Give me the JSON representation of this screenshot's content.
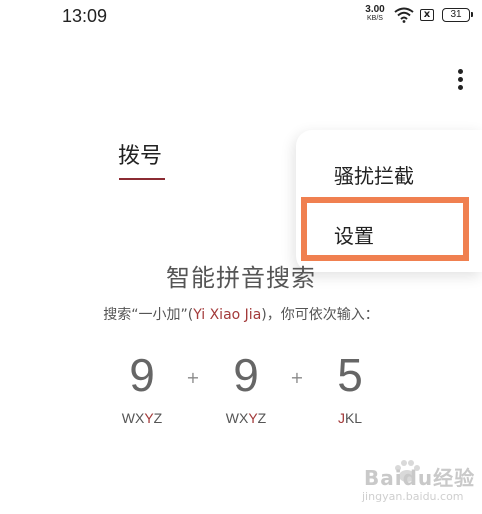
{
  "status_bar": {
    "time": "13:09",
    "net_speed_value": "3.00",
    "net_speed_unit": "KB/S",
    "sim_icon": "x",
    "battery": "31"
  },
  "tabs": {
    "dial": "拨号"
  },
  "menu": {
    "items": [
      {
        "label": "骚扰拦截"
      },
      {
        "label": "设置"
      }
    ],
    "highlighted_item": "设置",
    "highlight_color": "#f08050"
  },
  "smart_search": {
    "title": "智能拼音搜索",
    "hint_prefix": "搜索“一小加”(",
    "hint_pinyin": "Yi Xiao Jia",
    "hint_suffix": ")，你可依次输入：",
    "keys": [
      {
        "digit": "9",
        "letters_pre": "WX",
        "letters_hl": "Y",
        "letters_post": "Z"
      },
      {
        "digit": "9",
        "letters_pre": "WX",
        "letters_hl": "Y",
        "letters_post": "Z"
      },
      {
        "digit": "5",
        "letters_pre": "",
        "letters_hl": "J",
        "letters_post": "KL"
      }
    ],
    "plus": "+"
  },
  "watermark": {
    "text": "Baidu经验",
    "sub": "jingyan.baidu.com"
  },
  "colors": {
    "accent": "#8b2b33",
    "pinyin": "#a33a3a"
  }
}
